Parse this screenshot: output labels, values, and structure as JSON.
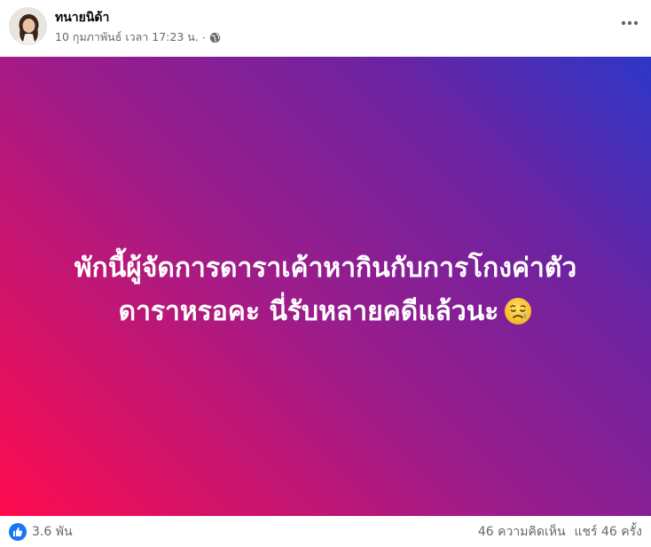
{
  "post": {
    "author": "ทนายนิด้า",
    "timestamp": "10 กุมภาพันธ์ เวลา 17:23 น.",
    "separator": "·",
    "privacy_icon": "globe-icon",
    "more_icon": "more-options-icon",
    "message_line1": "พักนี้ผู้จัดการดาราเค้าหากินกับการโกงค่าตัว",
    "message_line2": "ดาราหรอคะ นี่รับหลายคดีแล้วนะ",
    "message_emoji": "crying-face-emoji",
    "background_colors": [
      "#fe0b4e",
      "#9e1c8a",
      "#6c23a1",
      "#2d37c8"
    ]
  },
  "footer": {
    "reaction_icon": "like-icon",
    "reaction_count": "3.6 พัน",
    "comments": "46 ความคิดเห็น",
    "shares": "แชร์ 46 ครั้ง"
  },
  "colors": {
    "like_blue": "#1877f2",
    "secondary_text": "#65676b"
  }
}
